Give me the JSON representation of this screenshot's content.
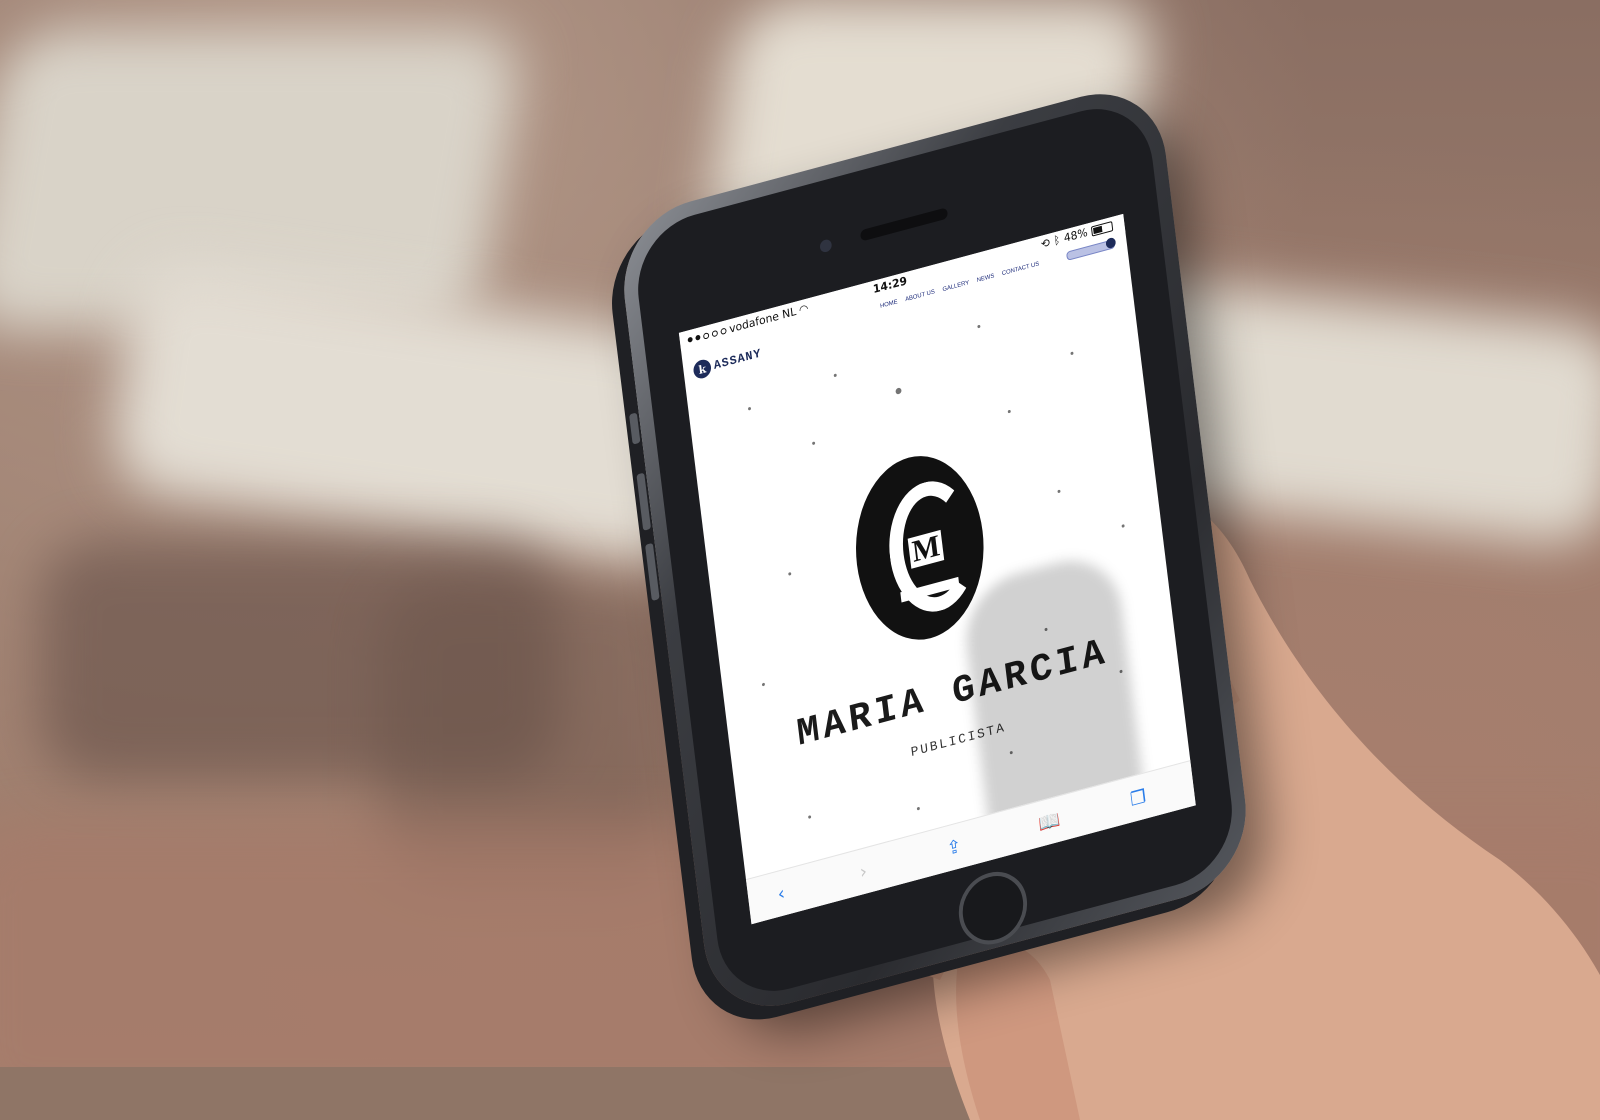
{
  "status_bar": {
    "carrier": "vodafone NL",
    "time": "14:29",
    "battery": "48%"
  },
  "site": {
    "logo_letter": "k",
    "logo_text": "ASSANY",
    "menu": [
      "HOME",
      "ABOUT US",
      "GALLERY",
      "NEWS",
      "CONTACT US"
    ]
  },
  "hero": {
    "monogram_letter": "M",
    "name": "MARIA GARCIA",
    "role": "PUBLICISTA"
  },
  "toolbar": {
    "back": "‹",
    "forward": "›",
    "share": "⇪",
    "bookmarks": "📖",
    "tabs": "❐"
  },
  "colors": {
    "brand": "#1d2b5a",
    "nail_polish": "#d85a72",
    "phone_body": "#2a2b2f"
  }
}
